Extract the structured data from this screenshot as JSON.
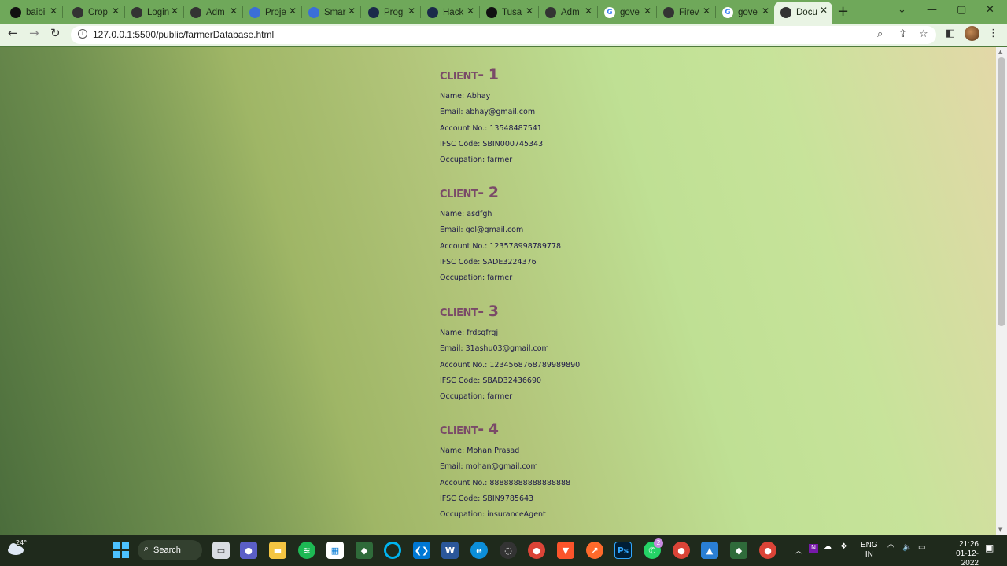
{
  "browser": {
    "tabs": [
      {
        "title": "baibi",
        "icon": "github-icon",
        "color": "#111111"
      },
      {
        "title": "Crop",
        "icon": "globe-icon",
        "color": "#333333"
      },
      {
        "title": "Login",
        "icon": "globe-icon",
        "color": "#333333"
      },
      {
        "title": "Adm",
        "icon": "globe-icon",
        "color": "#333333"
      },
      {
        "title": "Proje",
        "icon": "canva-icon",
        "color": "#3b6fd8"
      },
      {
        "title": "Smar",
        "icon": "canva-icon",
        "color": "#3b6fd8"
      },
      {
        "title": "Prog",
        "icon": "hackerrank-icon",
        "color": "#1b2a4a"
      },
      {
        "title": "Hack",
        "icon": "hackerrank-icon",
        "color": "#1b2a4a"
      },
      {
        "title": "Tusa",
        "icon": "github-icon",
        "color": "#111111"
      },
      {
        "title": "Adm",
        "icon": "globe-icon",
        "color": "#333333"
      },
      {
        "title": "gove",
        "icon": "google-icon",
        "color": "#ffffff"
      },
      {
        "title": "Firev",
        "icon": "globe-icon",
        "color": "#333333"
      },
      {
        "title": "gove",
        "icon": "google-icon",
        "color": "#ffffff"
      },
      {
        "title": "Docu",
        "icon": "globe-icon",
        "color": "#333333",
        "active": true
      }
    ],
    "url": "127.0.0.1:5500/public/farmerDatabase.html"
  },
  "clients": [
    {
      "heading": "Client- 1",
      "name": "Name: Abhay",
      "email": "Email: abhay@gmail.com",
      "account": "Account No.: 13548487541",
      "ifsc": "IFSC Code: SBIN000745343",
      "occupation": "Occupation: farmer"
    },
    {
      "heading": "Client- 2",
      "name": "Name: asdfgh",
      "email": "Email: gol@gmail.com",
      "account": "Account No.: 123578998789778",
      "ifsc": "IFSC Code: SADE3224376",
      "occupation": "Occupation: farmer"
    },
    {
      "heading": "Client- 3",
      "name": "Name: frdsgfrgj",
      "email": "Email: 31ashu03@gmail.com",
      "account": "Account No.: 1234568768789989890",
      "ifsc": "IFSC Code: SBAD32436690",
      "occupation": "Occupation: farmer"
    },
    {
      "heading": "Client- 4",
      "name": "Name: Mohan Prasad",
      "email": "Email: mohan@gmail.com",
      "account": "Account No.: 88888888888888888",
      "ifsc": "IFSC Code: SBIN9785643",
      "occupation": "Occupation: insuranceAgent"
    }
  ],
  "taskbar": {
    "weather_temp": "24°",
    "search_label": "Search",
    "language": "ENG",
    "region": "IN",
    "time": "21:26",
    "date": "01-12-2022",
    "whatsapp_badge": "2"
  },
  "colors": {
    "heading": "#7a4a68",
    "field_text": "#1d1848"
  }
}
